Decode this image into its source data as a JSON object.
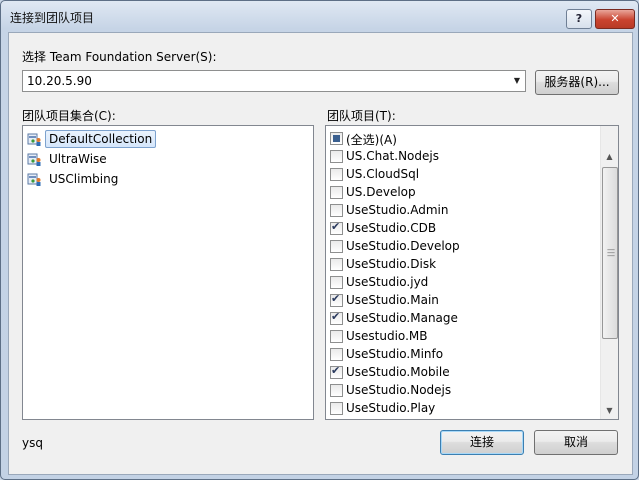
{
  "window": {
    "title": "连接到团队项目",
    "help_label": "?",
    "close_label": "✕"
  },
  "server": {
    "label": "选择 Team Foundation Server(S):",
    "selected": "10.20.5.90",
    "servers_button": "服务器(R)..."
  },
  "collections": {
    "label": "团队项目集合(C):",
    "items": [
      {
        "label": "DefaultCollection",
        "selected": true
      },
      {
        "label": "UltraWise",
        "selected": false
      },
      {
        "label": "USClimbing",
        "selected": false
      }
    ]
  },
  "projects": {
    "label": "团队项目(T):",
    "select_all_label": "(全选)(A)",
    "items": [
      {
        "label": "US.Chat.Nodejs",
        "checked": false
      },
      {
        "label": "US.CloudSql",
        "checked": false
      },
      {
        "label": "US.Develop",
        "checked": false
      },
      {
        "label": "UseStudio.Admin",
        "checked": false
      },
      {
        "label": "UseStudio.CDB",
        "checked": true
      },
      {
        "label": "UseStudio.Develop",
        "checked": false
      },
      {
        "label": "UseStudio.Disk",
        "checked": false
      },
      {
        "label": "UseStudio.jyd",
        "checked": false
      },
      {
        "label": "UseStudio.Main",
        "checked": true
      },
      {
        "label": "UseStudio.Manage",
        "checked": true
      },
      {
        "label": "Usestudio.MB",
        "checked": false
      },
      {
        "label": "UseStudio.Minfo",
        "checked": false
      },
      {
        "label": "UseStudio.Mobile",
        "checked": true
      },
      {
        "label": "UseStudio.Nodejs",
        "checked": false
      },
      {
        "label": "UseStudio.Play",
        "checked": false
      }
    ]
  },
  "footer": {
    "user": "ysq",
    "connect_button": "连接",
    "cancel_button": "取消"
  },
  "colors": {
    "accent": "#3c7fb1",
    "selection": "#d5e6fb",
    "title_gradient": "#c6d4e6"
  }
}
